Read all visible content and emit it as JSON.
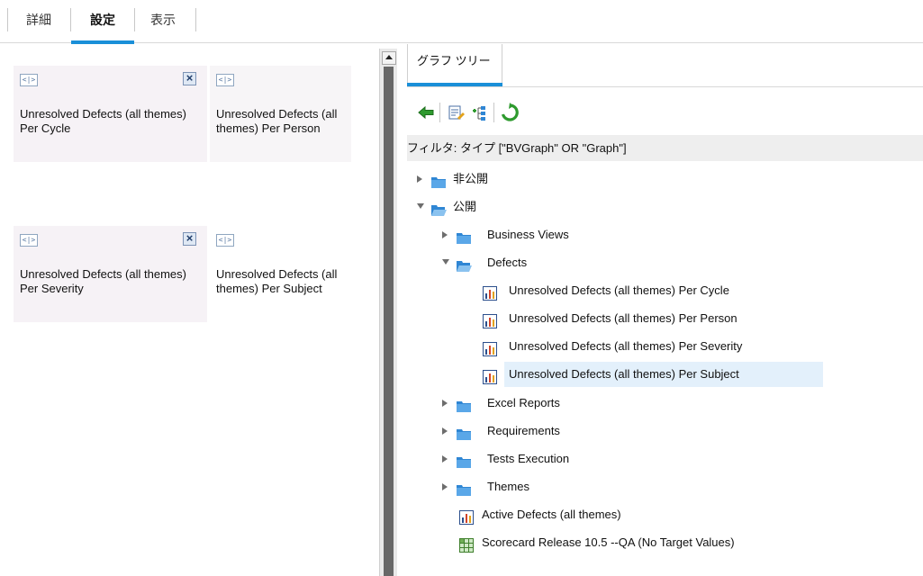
{
  "top_tabs": [
    {
      "label": "詳細",
      "active": false
    },
    {
      "label": "設定",
      "active": true
    },
    {
      "label": "表示",
      "active": false
    }
  ],
  "tiles": [
    {
      "chip": "<|>",
      "text": "Unresolved Defects (all themes) Per Cycle",
      "closable": true
    },
    {
      "chip": "<|>",
      "text": "Unresolved Defects (all themes) Per Person",
      "closable": false
    },
    {
      "chip": "<|>",
      "text": "Unresolved Defects (all themes) Per Severity",
      "closable": true
    },
    {
      "chip": "<|>",
      "text": "Unresolved Defects (all themes) Per Subject",
      "closable": false
    }
  ],
  "right_panel": {
    "tab_label": "グラフ ツリー",
    "filter_text": "フィルタ: タイプ [\"BVGraph\" OR \"Graph\"]",
    "toolbar": {
      "back_icon": "back-arrow-icon",
      "properties_icon": "properties-icon",
      "tree_icon": "tree-expand-icon",
      "refresh_icon": "refresh-icon"
    },
    "tree": [
      {
        "label": "非公開",
        "type": "folder",
        "expanded": false,
        "level": 0
      },
      {
        "label": "公開",
        "type": "folder",
        "expanded": true,
        "level": 0
      },
      {
        "label": "Business Views",
        "type": "folder",
        "expanded": false,
        "level": 1
      },
      {
        "label": "Defects",
        "type": "folder",
        "expanded": true,
        "level": 1
      },
      {
        "label": "Unresolved Defects (all themes) Per Cycle",
        "type": "graph",
        "level": 2
      },
      {
        "label": "Unresolved Defects (all themes) Per Person",
        "type": "graph",
        "level": 2
      },
      {
        "label": "Unresolved Defects (all themes) Per Severity",
        "type": "graph",
        "level": 2
      },
      {
        "label": "Unresolved Defects (all themes) Per Subject",
        "type": "graph",
        "level": 2,
        "selected": true
      },
      {
        "label": "Excel Reports",
        "type": "folder",
        "expanded": false,
        "level": 1
      },
      {
        "label": "Requirements",
        "type": "folder",
        "expanded": false,
        "level": 1
      },
      {
        "label": "Tests Execution",
        "type": "folder",
        "expanded": false,
        "level": 1
      },
      {
        "label": "Themes",
        "type": "folder",
        "expanded": false,
        "level": 1
      },
      {
        "label": "Active Defects (all themes)",
        "type": "graph",
        "level": 1
      },
      {
        "label": "Scorecard Release 10.5 --QA (No Target Values)",
        "type": "scorecard",
        "level": 1
      }
    ]
  },
  "colors": {
    "accent": "#1a8fd8",
    "selected_row": "#e3f0fb",
    "tile_bg": "#f6f2f6",
    "folder_blue": "#2f86d4",
    "refresh_green": "#2e9a2e"
  }
}
